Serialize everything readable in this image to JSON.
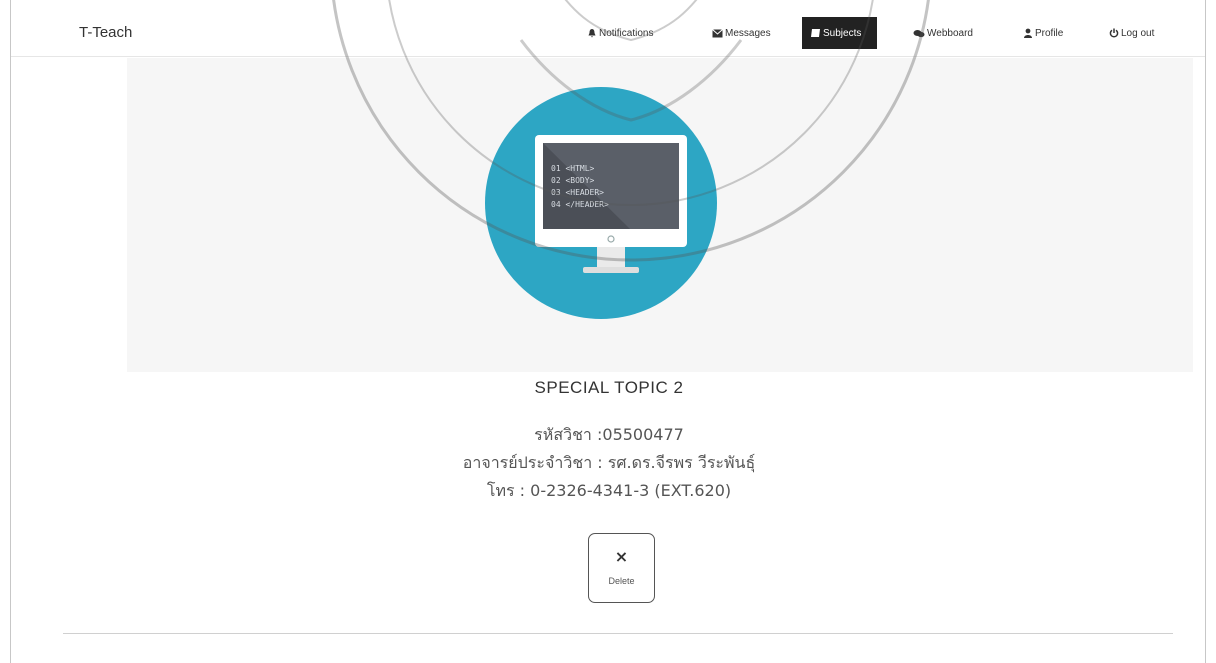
{
  "navbar": {
    "brand": "T-Teach",
    "items": [
      {
        "label": "Notifications",
        "icon": "bell-icon",
        "active": false
      },
      {
        "label": "Messages",
        "icon": "envelope-icon",
        "active": false
      },
      {
        "label": "Subjects",
        "icon": "book-icon",
        "active": true
      },
      {
        "label": "Webboard",
        "icon": "comments-icon",
        "active": false
      },
      {
        "label": "Profile",
        "icon": "user-icon",
        "active": false
      },
      {
        "label": "Log out",
        "icon": "power-icon",
        "active": false
      }
    ]
  },
  "subject": {
    "title": "SPECIAL TOPIC 2",
    "code_line": "รหัสวิชา :05500477",
    "teacher_line": "อาจารย์ประจำวิชา : รศ.ดร.จีรพร วีระพันธุ์",
    "phone_line": "โทร : 0-2326-4341-3 (EXT.620)",
    "image_code_lines": [
      "01 <HTML>",
      "02 <BODY>",
      "03 <HEADER>",
      "04 </HEADER>"
    ]
  },
  "actions": {
    "delete_icon": "×",
    "delete_label": "Delete"
  },
  "colors": {
    "accent_circle": "#2da6c4",
    "active_nav": "#222222"
  }
}
